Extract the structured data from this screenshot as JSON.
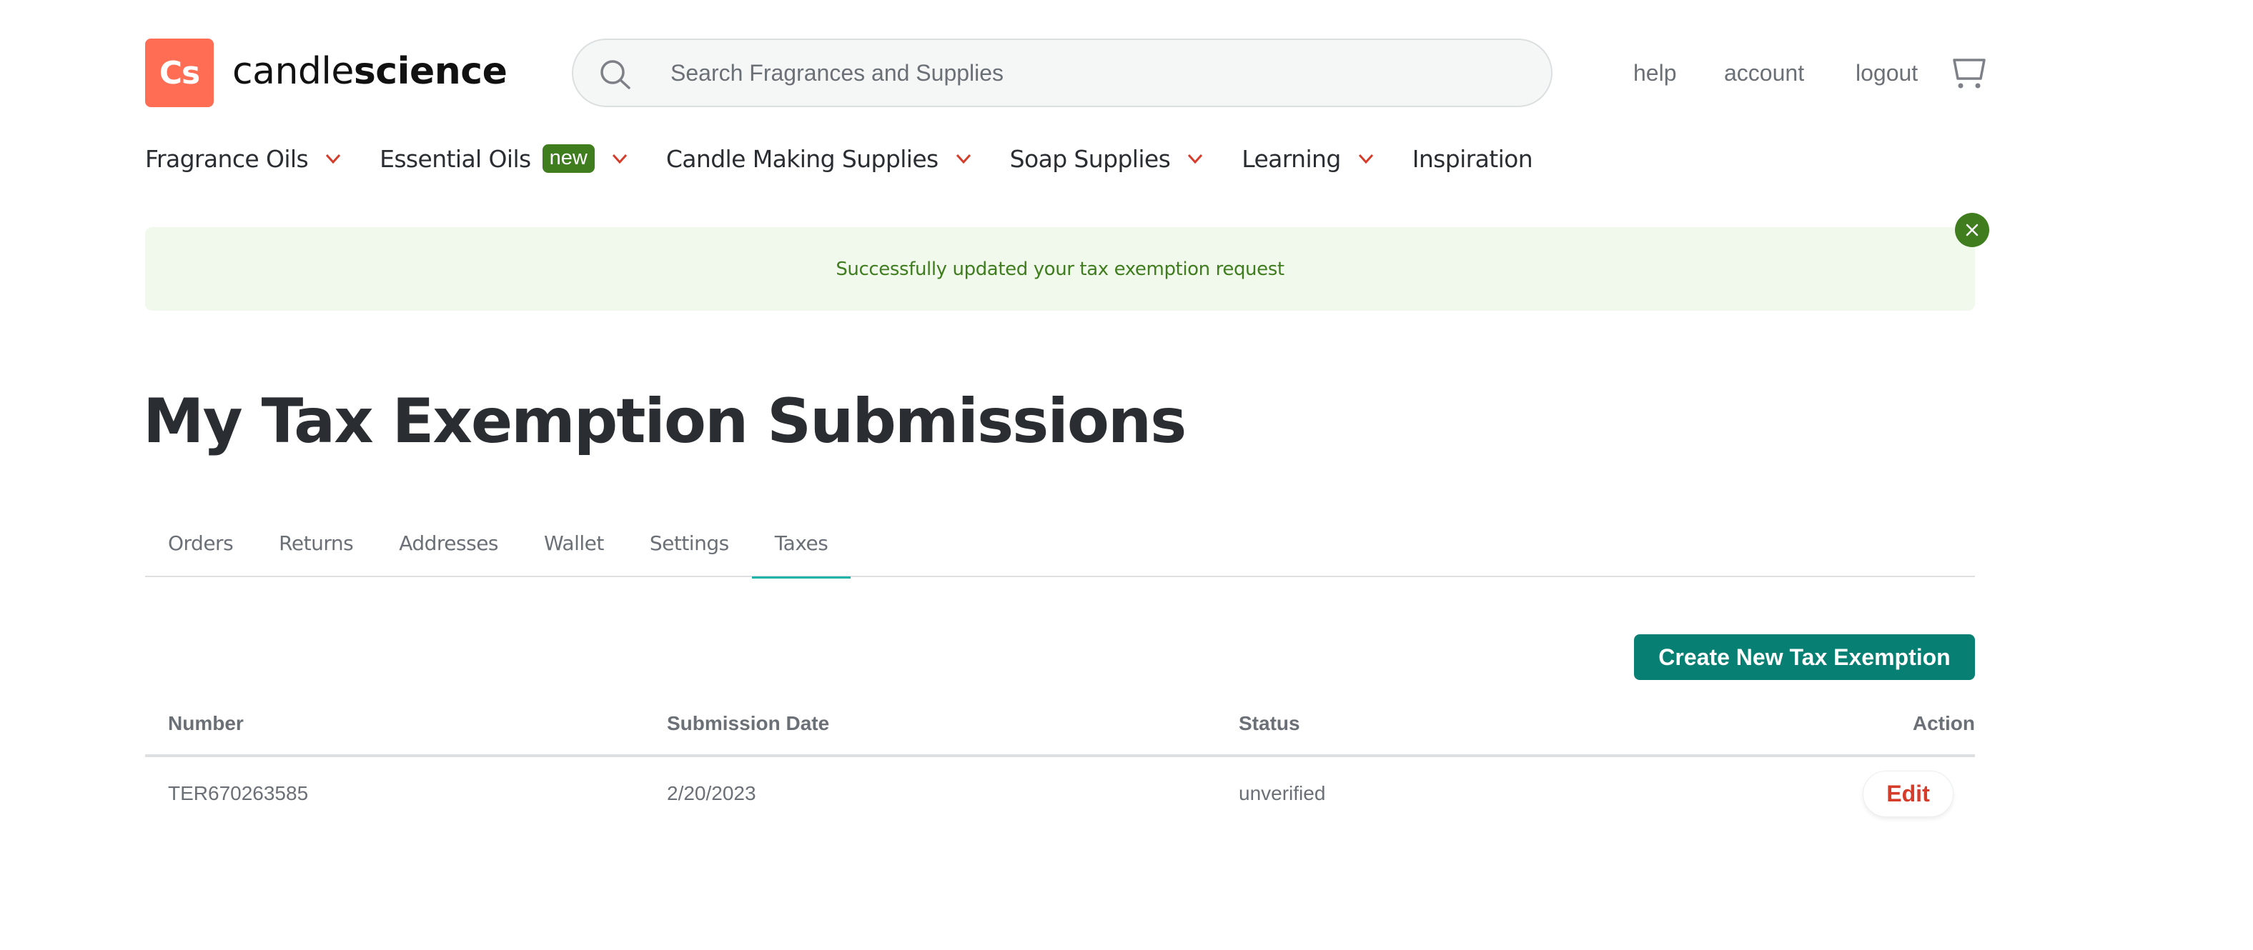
{
  "header": {
    "logo_mark": "Cs",
    "brand_light": "candle",
    "brand_bold": "science",
    "search": {
      "placeholder": "Search Fragrances and Supplies",
      "value": ""
    },
    "links": {
      "help": "help",
      "account": "account",
      "logout": "logout"
    },
    "icons": {
      "search": "search-icon",
      "cart": "cart-icon"
    }
  },
  "nav": {
    "items": [
      {
        "label": "Fragrance Oils",
        "has_dropdown": true
      },
      {
        "label": "Essential Oils",
        "badge": "new",
        "has_dropdown": true
      },
      {
        "label": "Candle Making Supplies",
        "has_dropdown": true
      },
      {
        "label": "Soap Supplies",
        "has_dropdown": true
      },
      {
        "label": "Learning",
        "has_dropdown": true
      },
      {
        "label": "Inspiration",
        "has_dropdown": false
      }
    ]
  },
  "alert": {
    "message": "Successfully updated your tax exemption request",
    "type": "success",
    "close_icon": "close-icon"
  },
  "page": {
    "title": "My Tax Exemption Submissions"
  },
  "tabs": {
    "items": [
      {
        "label": "Orders",
        "active": false
      },
      {
        "label": "Returns",
        "active": false
      },
      {
        "label": "Addresses",
        "active": false
      },
      {
        "label": "Wallet",
        "active": false
      },
      {
        "label": "Settings",
        "active": false
      },
      {
        "label": "Taxes",
        "active": true
      }
    ]
  },
  "actions": {
    "create_label": "Create New Tax Exemption"
  },
  "table": {
    "columns": [
      "Number",
      "Submission Date",
      "Status",
      "Action"
    ],
    "rows": [
      {
        "number": "TER670263585",
        "submission_date": "2/20/2023",
        "status": "unverified",
        "action": "Edit"
      }
    ]
  },
  "colors": {
    "brand": "#ff6d55",
    "success": "#3f7d1f",
    "success_bg": "#f1f8ec",
    "primary_button": "#077f72",
    "tab_active": "#16b3a8",
    "danger_text": "#d63c2a",
    "chevron": "#d63c2a"
  }
}
